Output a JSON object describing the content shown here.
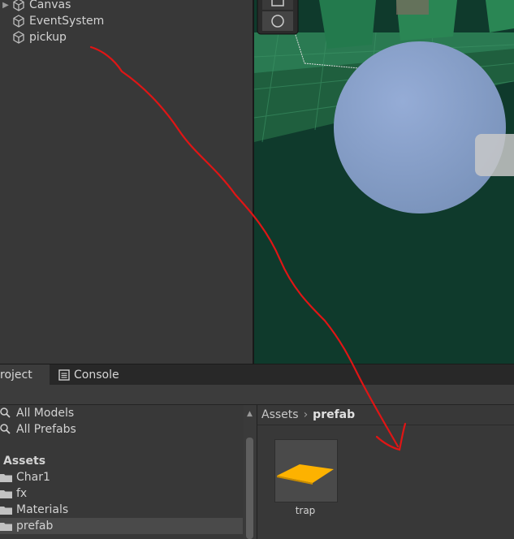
{
  "hierarchy": {
    "items": [
      {
        "label": "Canvas",
        "expandable": true
      },
      {
        "label": "EventSystem",
        "expandable": false
      },
      {
        "label": "pickup",
        "expandable": false
      }
    ]
  },
  "tabs": [
    {
      "label": "roject",
      "icon": "project-tab-icon"
    },
    {
      "label": "Console",
      "icon": "console-icon"
    }
  ],
  "project": {
    "favorites": [
      "All Models",
      "All Prefabs"
    ],
    "assets_header": "Assets",
    "folders": [
      "Char1",
      "fx",
      "Materials",
      "prefab"
    ],
    "selected_folder": "prefab",
    "breadcrumb": {
      "root": "Assets",
      "current": "prefab"
    },
    "assets": [
      {
        "name": "trap",
        "color": "#fdb200"
      }
    ]
  },
  "colors": {
    "annotation": "#e01515",
    "sphere": "#8aa2c8",
    "ground": "#2f7650",
    "selection": "#4a4a4a"
  }
}
